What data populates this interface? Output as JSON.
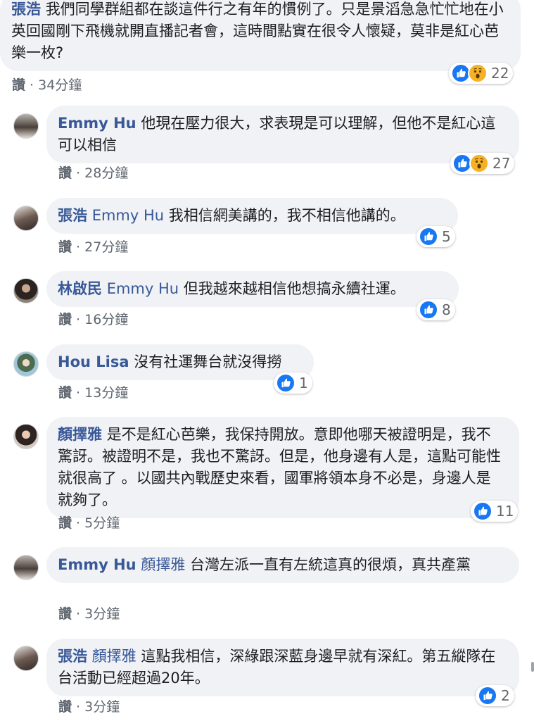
{
  "colors": {
    "name": "#385898",
    "bubble": "#f0f2f5",
    "meta": "#606770",
    "like_blue": "#1877f2",
    "wow_yellow": "#f7b125"
  },
  "comments": [
    {
      "name": "張浩",
      "mention": "",
      "text": "我們同學群組都在談這件行之有年的慣例了。只是景滔急急忙忙地在小英回國剛下飛機就開直播記者會，這時間點實在很令人懷疑，莫非是紅心芭樂一枚?",
      "action": "讚",
      "time": "34分鐘",
      "reactions": [
        "like-icon",
        "wow-icon"
      ],
      "count": "22"
    },
    {
      "name": "Emmy Hu",
      "mention": "",
      "text": "他現在壓力很大，求表現是可以理解，但他不是紅心這可以相信",
      "action": "讚",
      "time": "28分鐘",
      "reactions": [
        "like-icon",
        "wow-icon"
      ],
      "count": "27"
    },
    {
      "name": "張浩",
      "mention": "Emmy Hu",
      "text": "我相信網美講的，我不相信他講的。",
      "action": "讚",
      "time": "27分鐘",
      "reactions": [
        "like-icon"
      ],
      "count": "5"
    },
    {
      "name": "林啟民",
      "mention": "Emmy Hu",
      "text": "但我越來越相信他想搞永續社運。",
      "action": "讚",
      "time": "16分鐘",
      "reactions": [
        "like-icon"
      ],
      "count": "8"
    },
    {
      "name": "Hou Lisa",
      "mention": "",
      "text": "沒有社運舞台就沒得撈",
      "action": "讚",
      "time": "13分鐘",
      "reactions": [
        "like-icon"
      ],
      "count": "1"
    },
    {
      "name": "顏擇雅",
      "mention": "",
      "text": "是不是紅心芭樂，我保持開放。意即他哪天被證明是，我不驚訝。被證明不是，我也不驚訝。但是，他身邊有人是，這點可能性就很高了 。以國共內戰歷史來看，國軍將領本身不必是，身邊人是就夠了。",
      "action": "讚",
      "time": "5分鐘",
      "reactions": [
        "like-icon"
      ],
      "count": "11"
    },
    {
      "name": "Emmy Hu",
      "mention": "顏擇雅",
      "text": "台灣左派一直有左統這真的很煩，真共產黨",
      "action": "讚",
      "time": "3分鐘",
      "reactions": [],
      "count": ""
    },
    {
      "name": "張浩",
      "mention": "顏擇雅",
      "text": "這點我相信，深綠跟深藍身邊早就有深紅。第五縱隊在台活動已經超過20年。",
      "action": "讚",
      "time": "3分鐘",
      "reactions": [
        "like-icon"
      ],
      "count": "2"
    }
  ]
}
